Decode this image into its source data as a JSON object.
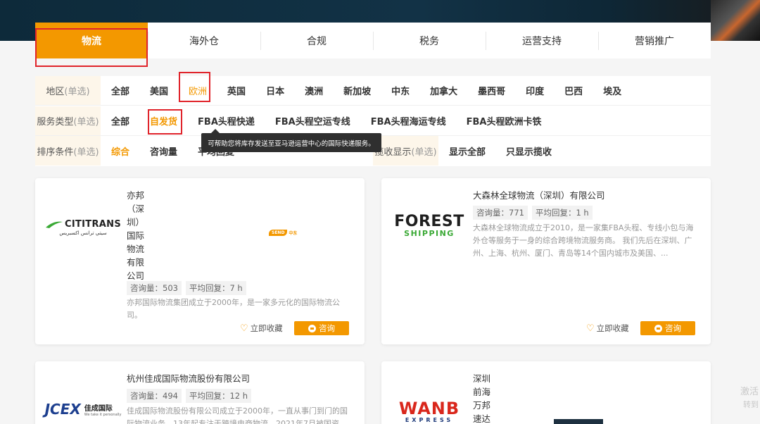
{
  "tabs": [
    {
      "label": "物流"
    },
    {
      "label": "海外仓"
    },
    {
      "label": "合规"
    },
    {
      "label": "税务"
    },
    {
      "label": "运营支持"
    },
    {
      "label": "营销推广"
    }
  ],
  "filters": {
    "region": {
      "label": "地区",
      "hint": "(单选)",
      "options": [
        "全部",
        "美国",
        "欧洲",
        "英国",
        "日本",
        "澳洲",
        "新加坡",
        "中东",
        "加拿大",
        "墨西哥",
        "印度",
        "巴西",
        "埃及"
      ],
      "selected": "欧洲"
    },
    "service": {
      "label": "服务类型",
      "hint": "(单选)",
      "options": [
        "全部",
        "自发货",
        "FBA头程快递",
        "FBA头程空运专线",
        "FBA头程海运专线",
        "FBA头程欧洲卡铁"
      ],
      "selected": "自发货"
    },
    "sort": {
      "label": "排序条件",
      "hint": "(单选)",
      "options": [
        "综合",
        "咨询量",
        "平均回复"
      ],
      "selected": "综合"
    },
    "display": {
      "label": "揽收显示",
      "hint": "(单选)",
      "options": [
        "显示全部",
        "只显示揽收"
      ]
    }
  },
  "tooltip": "可帮助您将库存发送至亚马逊运营中心的国际快递服务。",
  "cards": [
    {
      "logo_main": "CITITRANS",
      "logo_sub": "سيتي ترانس اكسبريس",
      "name": "亦邦（深圳）国际物流有限公司",
      "badge_send": "SEND",
      "badge_text": "中东",
      "inquiries": "咨询量：503",
      "reply": "平均回复：7 h",
      "desc": "亦邦国际物流集团成立于2000年，是一家多元化的国际物流公司。",
      "fav": "立即收藏",
      "consult": "咨询"
    },
    {
      "logo_main": "FOREST",
      "logo_sub": "SHIPPING",
      "name": "大森林全球物流（深圳）有限公司",
      "inquiries": "咨询量：771",
      "reply": "平均回复：1 h",
      "desc": "大森林全球物流成立于2010，是一家集FBA头程、专线小包与海外仓等服务于一身的综合跨境物流服务商。 我们先后在深圳、广州、上海、杭州、厦门、青岛等14个国内城市及美国、...",
      "fav": "立即收藏",
      "consult": "咨询"
    },
    {
      "logo_main": "JCEX",
      "logo_cn": "佳成国际",
      "logo_sub": "We take it personally",
      "name": "杭州佳成国际物流股份有限公司",
      "inquiries": "咨询量：494",
      "reply": "平均回复：12 h",
      "desc": "佳成国际物流股份有限公司成立于2000年，一直从事门到门的国际物流业务，13年起专注于跨境电商物流，2021年7月被国资"
    },
    {
      "logo_main": "WANB",
      "logo_sub": "EXPRESS",
      "name": "深圳前海万邦速达"
    }
  ],
  "watermark": {
    "line1": "激活",
    "line2": "转到"
  }
}
